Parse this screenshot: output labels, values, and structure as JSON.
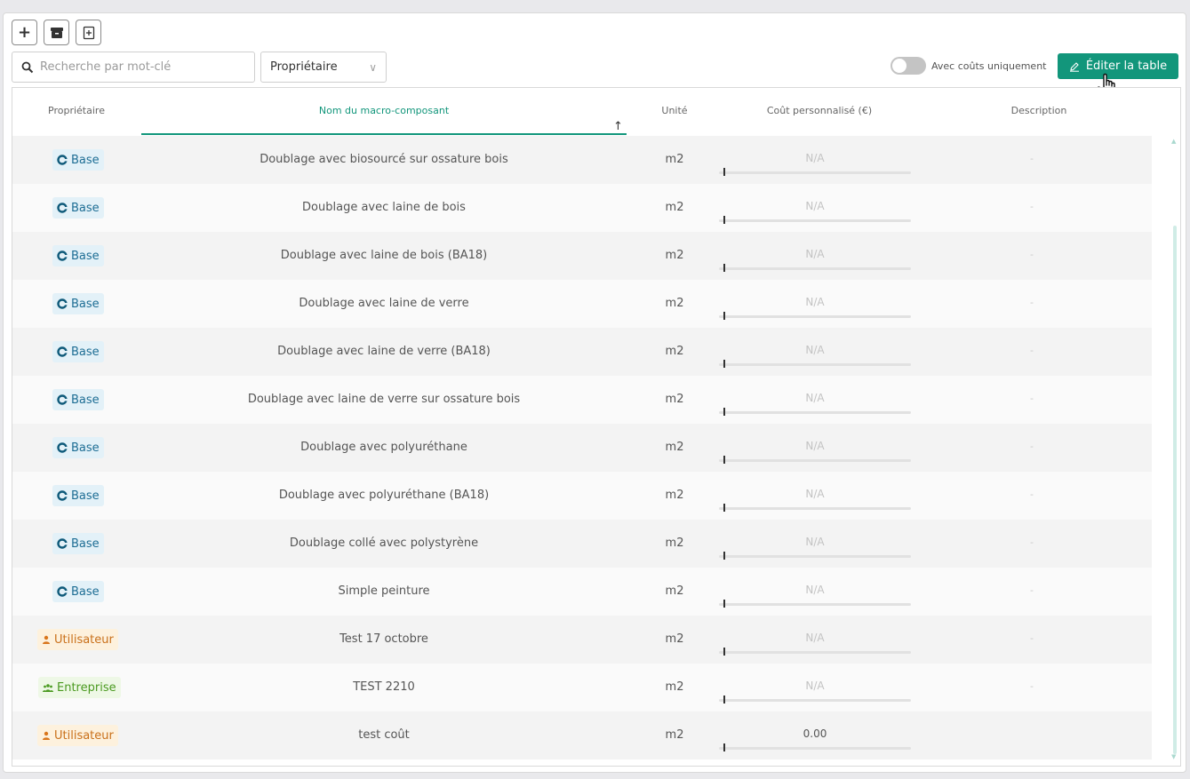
{
  "toolbar": {
    "add_label": "+",
    "search_placeholder": "Recherche par mot-clé",
    "owner_select": "Propriétaire",
    "toggle_label": "Avec coûts uniquement",
    "edit_label": "Éditer la table"
  },
  "colors": {
    "accent": "#12967b",
    "base_badge": "#1d6d94",
    "user_badge": "#c9701a",
    "enterprise_badge": "#4a9a20"
  },
  "table": {
    "headers": {
      "owner": "Propriétaire",
      "name": "Nom du macro-composant",
      "unit": "Unité",
      "cost": "Coût personnalisé (€)",
      "description": "Description"
    },
    "sort_arrow": "↑",
    "rows": [
      {
        "owner": "Base",
        "owner_type": "base",
        "name": "Doublage avec biosourcé sur ossature bois",
        "unit": "m2",
        "cost": "N/A",
        "desc": "-"
      },
      {
        "owner": "Base",
        "owner_type": "base",
        "name": "Doublage avec laine de bois",
        "unit": "m2",
        "cost": "N/A",
        "desc": "-"
      },
      {
        "owner": "Base",
        "owner_type": "base",
        "name": "Doublage avec laine de bois (BA18)",
        "unit": "m2",
        "cost": "N/A",
        "desc": "-"
      },
      {
        "owner": "Base",
        "owner_type": "base",
        "name": "Doublage avec laine de verre",
        "unit": "m2",
        "cost": "N/A",
        "desc": "-"
      },
      {
        "owner": "Base",
        "owner_type": "base",
        "name": "Doublage avec laine de verre (BA18)",
        "unit": "m2",
        "cost": "N/A",
        "desc": "-"
      },
      {
        "owner": "Base",
        "owner_type": "base",
        "name": "Doublage avec laine de verre sur ossature bois",
        "unit": "m2",
        "cost": "N/A",
        "desc": "-"
      },
      {
        "owner": "Base",
        "owner_type": "base",
        "name": "Doublage avec polyuréthane",
        "unit": "m2",
        "cost": "N/A",
        "desc": "-"
      },
      {
        "owner": "Base",
        "owner_type": "base",
        "name": "Doublage avec polyuréthane (BA18)",
        "unit": "m2",
        "cost": "N/A",
        "desc": "-"
      },
      {
        "owner": "Base",
        "owner_type": "base",
        "name": "Doublage collé avec polystyrène",
        "unit": "m2",
        "cost": "N/A",
        "desc": "-"
      },
      {
        "owner": "Base",
        "owner_type": "base",
        "name": "Simple peinture",
        "unit": "m2",
        "cost": "N/A",
        "desc": "-"
      },
      {
        "owner": "Utilisateur",
        "owner_type": "user",
        "name": "Test 17 octobre",
        "unit": "m2",
        "cost": "N/A",
        "desc": "-"
      },
      {
        "owner": "Entreprise",
        "owner_type": "ent",
        "name": "TEST 2210",
        "unit": "m2",
        "cost": "N/A",
        "desc": "-"
      },
      {
        "owner": "Utilisateur",
        "owner_type": "user",
        "name": "test coût",
        "unit": "m2",
        "cost": "0.00",
        "desc": ""
      }
    ]
  }
}
